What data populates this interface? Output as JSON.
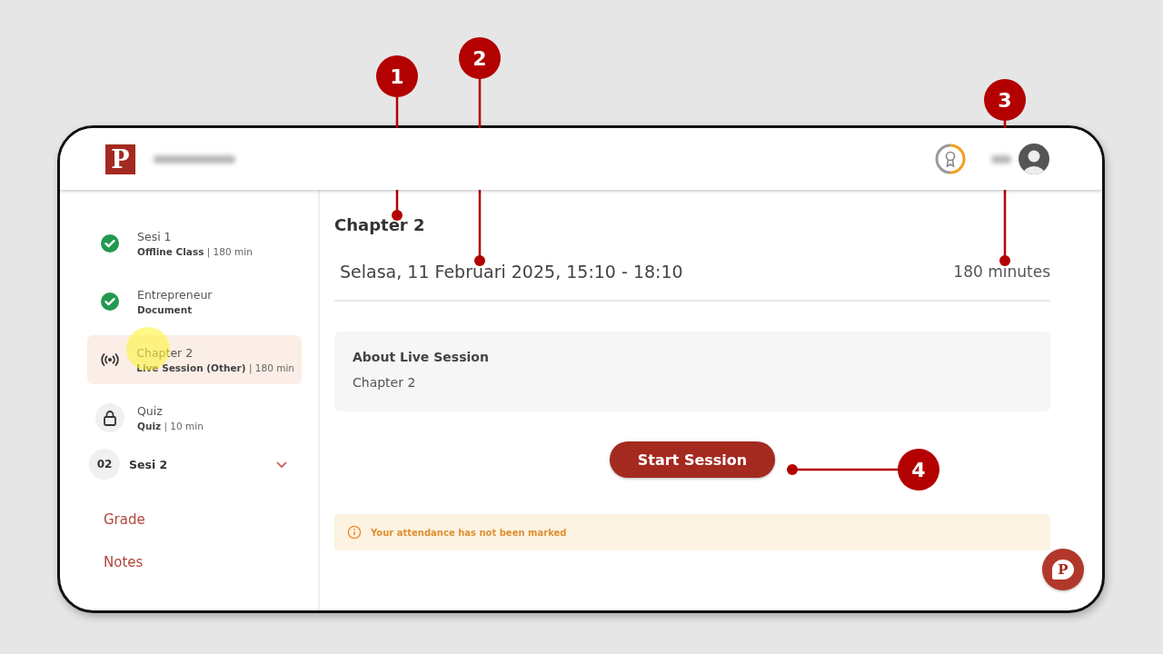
{
  "header": {
    "logo": "P"
  },
  "sidebar": {
    "items": [
      {
        "kind": "done",
        "title": "Sesi 1",
        "meta": "**Offline Class** | 180 min",
        "selected": false
      },
      {
        "kind": "done",
        "title": "Entrepreneur",
        "meta": "**Document**",
        "selected": false
      },
      {
        "kind": "live",
        "title": "Chapter 2",
        "meta": "**Live Session (Other)** | 180 min",
        "selected": true
      },
      {
        "kind": "locked",
        "title": "Quiz",
        "meta": "**Quiz** | 10 min",
        "selected": false
      }
    ],
    "section": {
      "number": "02",
      "title": "Sesi 2",
      "expanded": false
    },
    "links": [
      "Grade",
      "Notes"
    ]
  },
  "main": {
    "title": "Chapter 2",
    "datetime": "Selasa, 11 Februari 2025, 15:10 - 18:10",
    "duration": "180 minutes",
    "about": {
      "heading": "About Live Session",
      "text": "Chapter 2"
    },
    "button": "Start Session",
    "alert": "Your attendance has not been marked"
  },
  "chat_button": {
    "logo": "P"
  },
  "callouts": [
    {
      "number": "1"
    },
    {
      "number": "2"
    },
    {
      "number": "3"
    },
    {
      "number": "4"
    }
  ]
}
